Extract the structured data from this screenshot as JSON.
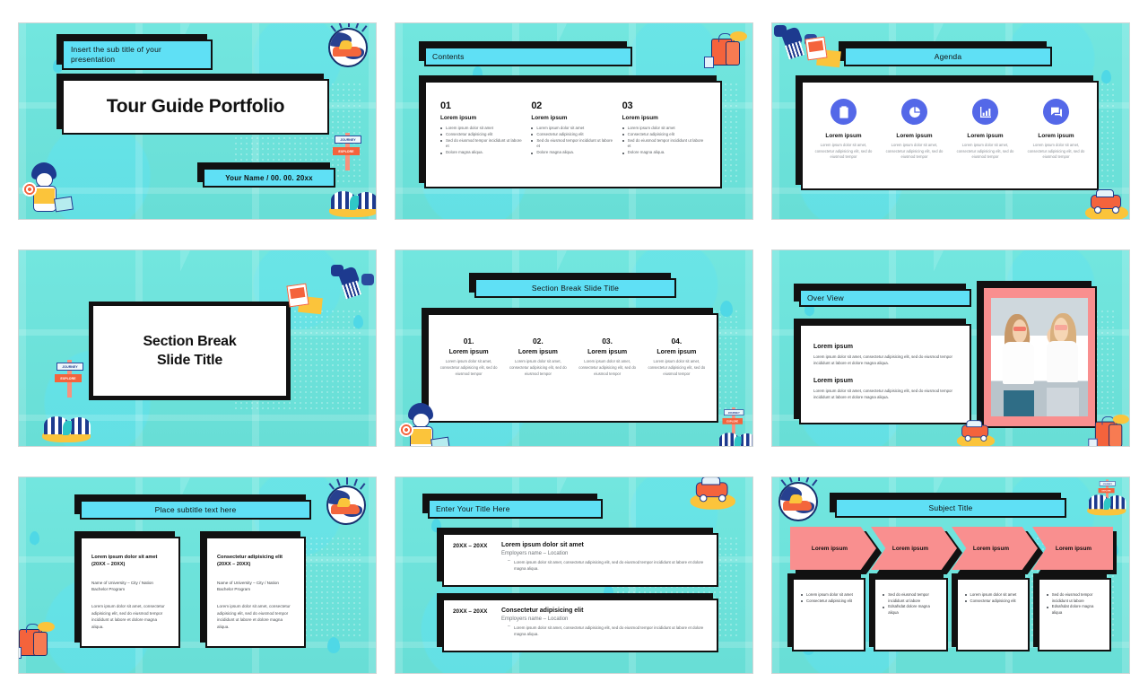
{
  "deck": {
    "theme": {
      "bg_teal": "#6fe3dc",
      "accent_cyan": "#5fe0f5",
      "ink_black": "#111111",
      "card_white": "#ffffff",
      "icon_blue": "#5468e8",
      "salmon_pink": "#f98f8f"
    }
  },
  "slide1": {
    "name": "title-slide",
    "subtitle": "Insert the sub title of your presentation",
    "title": "Tour Guide Portfolio",
    "byline": "Your Name  /  00. 00. 20xx",
    "decor": [
      "globe-plane-illustration",
      "journey-explore-signpost",
      "boy-with-map-illustration",
      "beach-umbrella-illustration"
    ]
  },
  "slide2": {
    "name": "contents-slide",
    "bar_title": "Contents",
    "columns": [
      {
        "number": "01",
        "heading": "Lorem ipsum",
        "bullets": [
          "Lorem ipsum dolor sit amet",
          "Consectetur adipisicing elit",
          "Sed do eiusmod tempor incididunt ut labore et",
          "Dolore magna aliqua."
        ]
      },
      {
        "number": "02",
        "heading": "Lorem ipsum",
        "bullets": [
          "Lorem ipsum dolor sit amet",
          "Consectetur adipisicing elit",
          "Sed do eiusmod tempor incididunt ut labore et",
          "Dolore magna aliqua."
        ]
      },
      {
        "number": "03",
        "heading": "Lorem ipsum",
        "bullets": [
          "Lorem ipsum dolor sit amet",
          "Consectetur adipisicing elit",
          "Sed do eiusmod tempor incididunt ut labore et",
          "Dolore magna aliqua."
        ]
      }
    ],
    "decor": [
      "suitcase-hat-passport-illustration"
    ]
  },
  "slide3": {
    "name": "agenda-slide",
    "bar_title": "Agenda",
    "items": [
      {
        "icon": "clipboard-checklist-icon",
        "heading": "Lorem ipsum",
        "desc": "Lorem ipsum dolor sit amet, consectetur adipisicing elit, sed do eiusmod tempor"
      },
      {
        "icon": "pie-chart-icon",
        "heading": "Lorem ipsum",
        "desc": "Lorem ipsum dolor sit amet, consectetur adipisicing elit, sed do eiusmod tempor"
      },
      {
        "icon": "bar-chart-growth-icon",
        "heading": "Lorem ipsum",
        "desc": "Lorem ipsum dolor sit amet, consectetur adipisicing elit, sed do eiusmod tempor"
      },
      {
        "icon": "chat-bubbles-icon",
        "heading": "Lorem ipsum",
        "desc": "Lorem ipsum dolor sit amet, consectetur adipisicing elit, sed do eiusmod tempor"
      }
    ],
    "decor": [
      "satellite-camera-postcard-illustration",
      "travel-car-illustration"
    ]
  },
  "slide4": {
    "name": "section-break-slide",
    "title_line1": "Section Break",
    "title_line2": "Slide Title",
    "decor": [
      "camera-postcard-illustration",
      "journey-explore-signpost",
      "beach-umbrella-illustration"
    ]
  },
  "slide5": {
    "name": "section-break-four-columns-slide",
    "bar_title": "Section Break Slide Title",
    "columns": [
      {
        "number": "01.",
        "heading": "Lorem ipsum",
        "desc": "Lorem ipsum dolor sit amet, consectetur adipisicing elit, sed do eiusmod tempor"
      },
      {
        "number": "02.",
        "heading": "Lorem ipsum",
        "desc": "Lorem ipsum dolor sit amet, consectetur adipisicing elit, sed do eiusmod tempor"
      },
      {
        "number": "03.",
        "heading": "Lorem ipsum",
        "desc": "Lorem ipsum dolor sit amet, consectetur adipisicing elit, sed do eiusmod tempor"
      },
      {
        "number": "04.",
        "heading": "Lorem ipsum",
        "desc": "Lorem ipsum dolor sit amet, consectetur adipisicing elit, sed do eiusmod tempor"
      }
    ],
    "decor": [
      "boy-with-map-illustration",
      "journey-explore-signpost",
      "map-pin"
    ]
  },
  "slide6": {
    "name": "over-view-slide",
    "bar_title": "Over View",
    "blocks": [
      {
        "heading": "Lorem ipsum",
        "body": "Lorem ipsum dolor sit amet, consectetur adipisicing elit, sed do eiusmod tempor incididunt ut labore et dolore magna aliqua."
      },
      {
        "heading": "Lorem ipsum",
        "body": "Lorem ipsum dolor sit amet, consectetur adipisicing elit, sed do eiusmod tempor incididunt ut labore et dolore magna aliqua."
      }
    ],
    "photo_alt": "two-women-in-sunglasses-photo",
    "decor": [
      "travel-car-illustration",
      "suitcase-hat-illustration"
    ]
  },
  "slide7": {
    "name": "education-two-cards-slide",
    "bar_title": "Place subtitle text here",
    "cards": [
      {
        "heading": "Lorem ipsum dolor sit amet (20XX – 20XX)",
        "meta": "Name of University – City / Nation Bachelor Program",
        "body": "Lorem ipsum dolor sit amet, consectetur adipisicing elit, sed do eiusmod tempor incididunt ut labore et dolore magna aliqua."
      },
      {
        "heading": "Consectetur adipisicing elit (20XX – 20XX)",
        "meta": "Name of University – City / Nation Bachelor Program",
        "body": "Lorem ipsum dolor sit amet, consectetur adipisicing elit, sed do eiusmod tempor incididunt ut labore et dolore magna aliqua."
      }
    ],
    "decor": [
      "globe-plane-illustration",
      "suitcase-hat-illustration",
      "map-pin"
    ]
  },
  "slide8": {
    "name": "experience-timeline-slide",
    "bar_title": "Enter Your Title Here",
    "rows": [
      {
        "years": "20XX – 20XX",
        "heading": "Lorem ipsum dolor sit amet",
        "subheading": "Employers name – Location",
        "bullets": [
          "Lorem ipsum dolor sit amet, consectetur adipisicing elit, sed do eiusmod tempor incididunt ut labore et dolore magna aliqua."
        ]
      },
      {
        "years": "20XX – 20XX",
        "heading": "Consectetur adipisicing elit",
        "subheading": "Employers name – Location",
        "bullets": [
          "Lorem ipsum dolor sit amet, consectetur adipisicing elit, sed do eiusmod tempor incididunt ut labore et dolore magna aliqua."
        ]
      }
    ],
    "decor": [
      "travel-car-on-globe-illustration",
      "map-pin"
    ]
  },
  "slide9": {
    "name": "subject-title-process-slide",
    "bar_title": "Subject Title",
    "arrows": [
      {
        "label": "Lorem ipsum"
      },
      {
        "label": "Lorem ipsum"
      },
      {
        "label": "Lorem ipsum"
      },
      {
        "label": "Lorem ipsum"
      }
    ],
    "cards": [
      {
        "bullets": [
          "Lorem ipsum dolor sit amet",
          "Consectetur adipisicing elit"
        ]
      },
      {
        "bullets": [
          "Sed do eiusmod tempor incididunt ut labore",
          "Edsafsdat dolore magna aliqua"
        ]
      },
      {
        "bullets": [
          "Lorem ipsum dolor sit amet",
          "Consectetur adipisicing elit"
        ]
      },
      {
        "bullets": [
          "Sed do eiusmod tempor incididunt ut labore",
          "Edsafsdat dolore magna aliqua"
        ]
      }
    ],
    "decor": [
      "globe-plane-illustration",
      "journey-explore-signpost",
      "beach-umbrella-illustration",
      "map-pin"
    ]
  },
  "signpost": {
    "top": "JOURNEY",
    "bottom": "EXPLORE"
  }
}
